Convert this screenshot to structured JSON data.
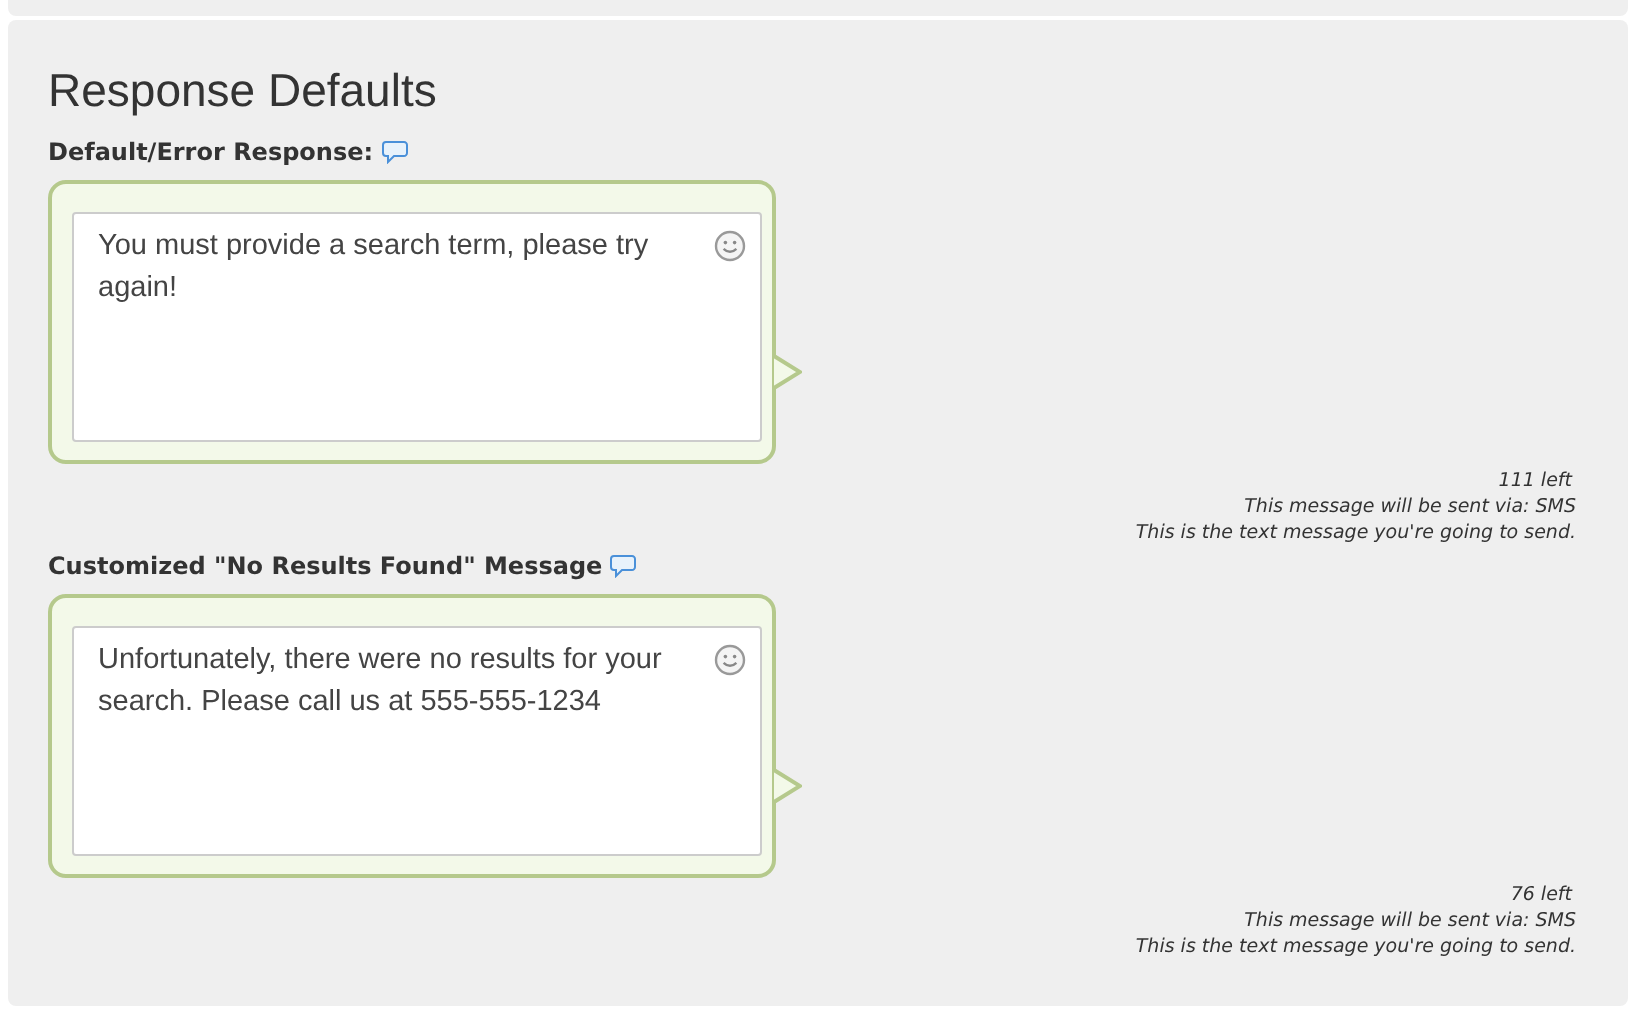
{
  "title": "Response Defaults",
  "messages": [
    {
      "label": "Default/Error Response:",
      "value": "You must provide a search term, please try again!",
      "remaining": "111 left",
      "via": "This message will be sent via: SMS",
      "hint": "This is the text message you're going to send."
    },
    {
      "label": "Customized \"No Results Found\" Message",
      "value": "Unfortunately, there were no results for your search. Please call us at 555-555-1234",
      "remaining": "76 left",
      "via": "This message will be sent via: SMS",
      "hint": "This is the text message you're going to send."
    }
  ]
}
